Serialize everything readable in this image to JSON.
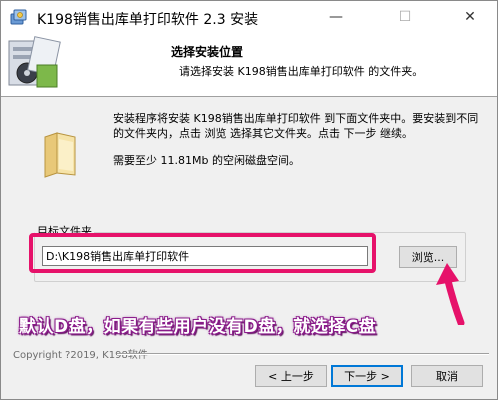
{
  "window": {
    "title": "K198销售出库单打印软件 2.3 安装",
    "minimize_glyph": "—",
    "maximize_glyph": "☐",
    "close_glyph": "✕"
  },
  "header": {
    "title": "选择安装位置",
    "subtitle": "请选择安装 K198销售出库单打印软件 的文件夹。"
  },
  "body": {
    "description": "安装程序将安装 K198销售出库单打印软件 到下面文件夹中。要安装到不同的文件夹内，点击 浏览 选择其它文件夹。点击 下一步 继续。",
    "space_required": "需要至少 11.81Mb 的空闲磁盘空间。"
  },
  "destination": {
    "group_label": "目标文件夹",
    "path_value": "D:\\K198销售出库单打印软件",
    "browse_label": "浏览..."
  },
  "annotation": {
    "text": "默认D盘，如果有些用户没有D盘，就选择C盘",
    "color": "#e6126a"
  },
  "footer": {
    "copyright": "Copyright ?2019, K198软件",
    "back_label": "< 上一步",
    "next_label": "下一步 >",
    "cancel_label": "取消"
  },
  "colors": {
    "highlight": "#e6126a",
    "default_button_border": "#0078d7"
  }
}
